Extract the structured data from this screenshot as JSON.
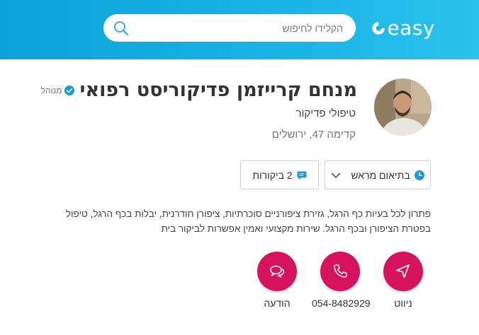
{
  "header": {
    "logo_text": "easy",
    "search": {
      "placeholder": "הקלידו לחיפוש"
    }
  },
  "business": {
    "title": "מנחם קרייזמן פדיקוריסט רפואי",
    "verified_label": "מנוהל",
    "category": "טיפולי פדיקור",
    "address": "קדימה 47, ירושלים"
  },
  "pills": {
    "schedule_label": "בתיאום מראש",
    "reviews_label": "2 ביקורות"
  },
  "description": "פתרון לכל בעיות כף הרגל, גזירת ציפורניים סוכרתיות, ציפורן חודרנית, יבלות בכף הרגל, טיפול בפטרת הציפורן ובכף הרגל. שירות מקצועי ואמין אפשרות לביקור בית",
  "actions": {
    "navigate_label": "ניווט",
    "phone_label": "054-8482929",
    "message_label": "הודעה"
  },
  "colors": {
    "header": "#19b5e6",
    "accent": "#d6145e",
    "icon_blue": "#1a9ad6"
  }
}
